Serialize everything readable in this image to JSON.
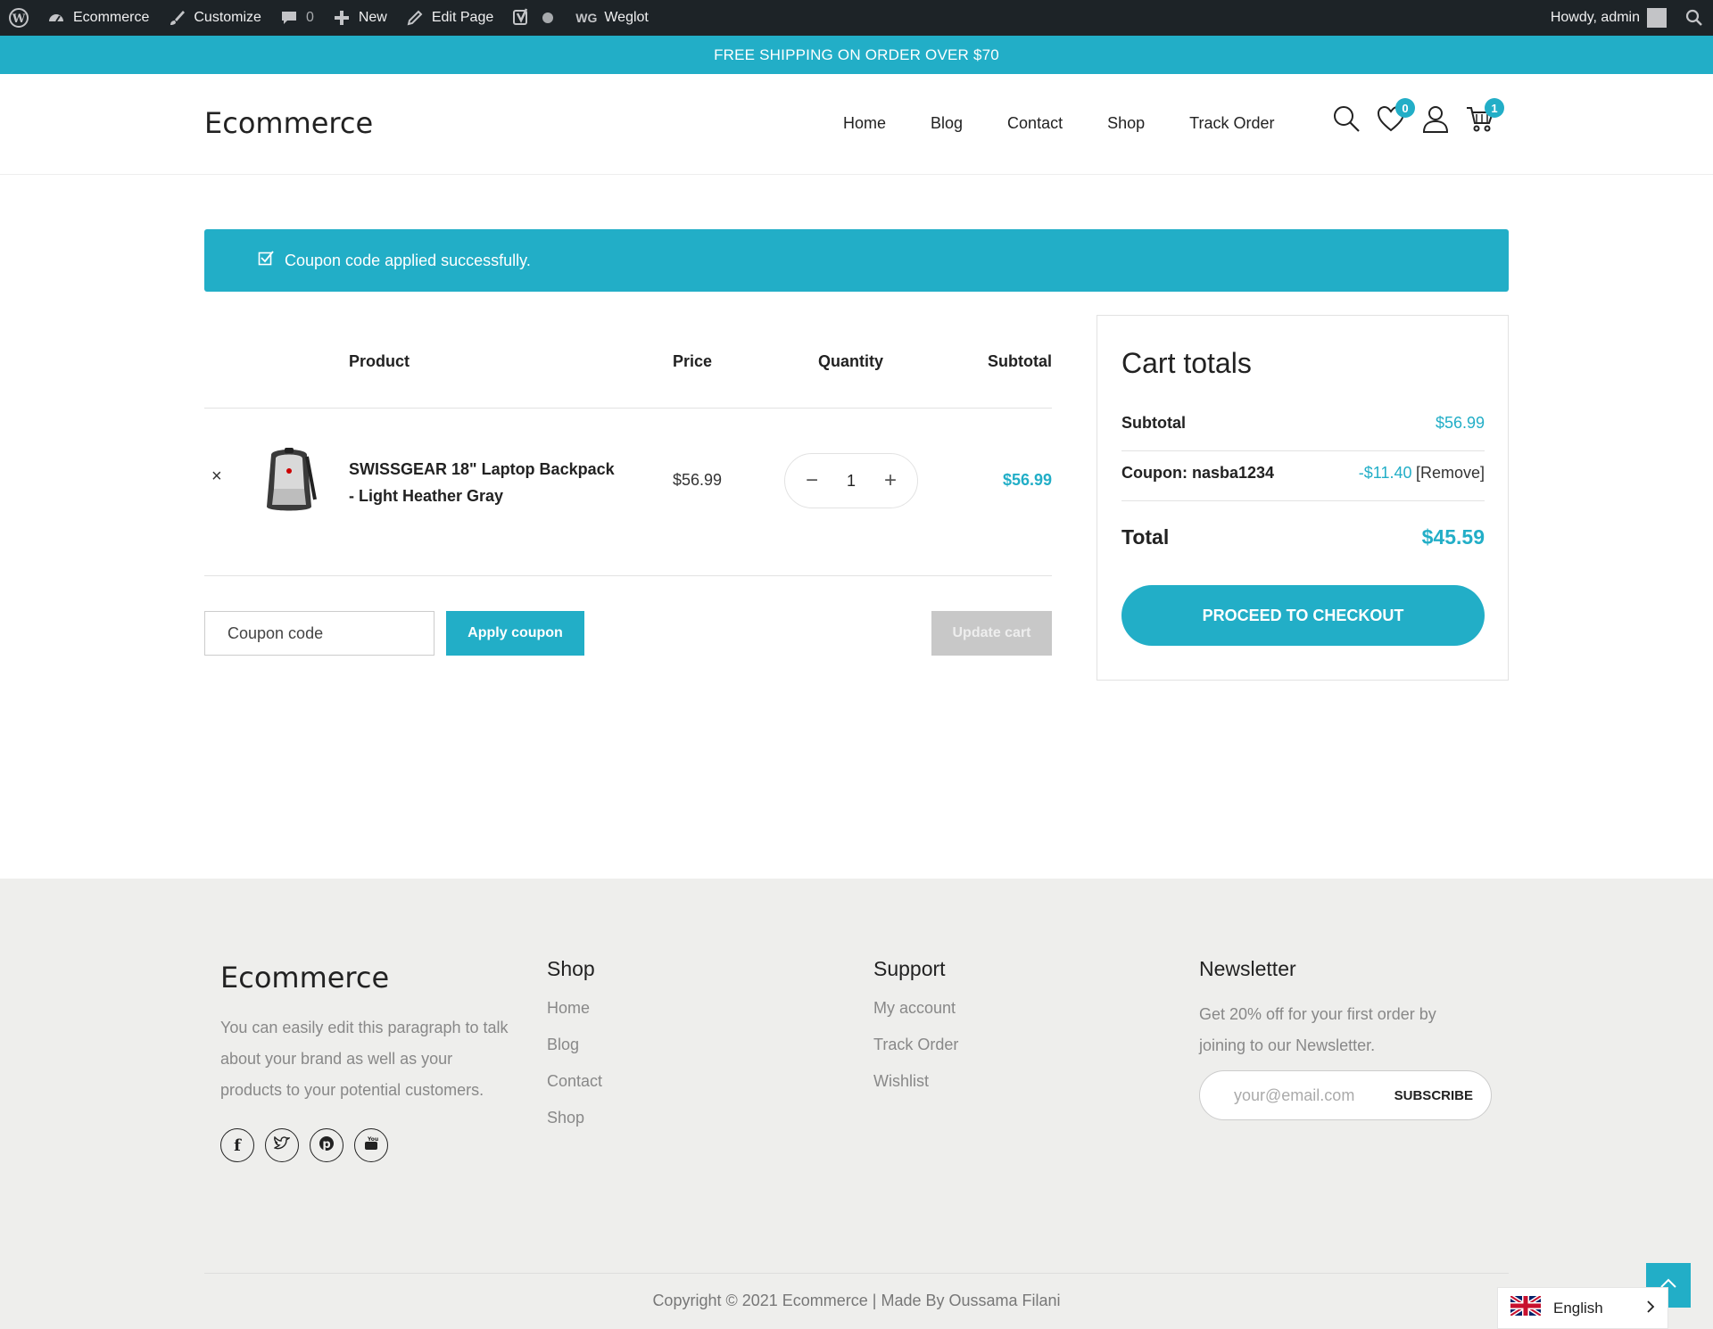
{
  "adminbar": {
    "site_name": "Ecommerce",
    "customize": "Customize",
    "comments_count": "0",
    "new": "New",
    "edit_page": "Edit Page",
    "weglot_prefix": "WG",
    "weglot": "Weglot",
    "howdy": "Howdy, admin"
  },
  "promo": {
    "text": "FREE SHIPPING ON ORDER OVER $70"
  },
  "header": {
    "logo": "Ecommerce",
    "nav": [
      "Home",
      "Blog",
      "Contact",
      "Shop",
      "Track Order"
    ],
    "wishlist_count": "0",
    "cart_count": "1"
  },
  "notice": {
    "text": "Coupon code applied successfully."
  },
  "cart": {
    "headers": {
      "product": "Product",
      "price": "Price",
      "quantity": "Quantity",
      "subtotal": "Subtotal"
    },
    "remove": "×",
    "item": {
      "name": "SWISSGEAR 18\" Laptop Backpack - Light Heather Gray",
      "price": "$56.99",
      "quantity": "1",
      "subtotal": "$56.99"
    },
    "coupon_placeholder": "Coupon code",
    "apply_label": "Apply coupon",
    "update_label": "Update cart"
  },
  "totals": {
    "title": "Cart totals",
    "subtotal_label": "Subtotal",
    "subtotal_value": "$56.99",
    "coupon_label": "Coupon: nasba1234",
    "coupon_value": "-$11.40",
    "coupon_remove": "[Remove]",
    "total_label": "Total",
    "total_value": "$45.59",
    "checkout_label": "PROCEED TO CHECKOUT"
  },
  "footer": {
    "logo": "Ecommerce",
    "about": "You can easily edit this paragraph to talk about your brand as well as your products to your potential customers.",
    "shop_title": "Shop",
    "shop_links": [
      "Home",
      "Blog",
      "Contact",
      "Shop"
    ],
    "support_title": "Support",
    "support_links": [
      "My account",
      "Track Order",
      "Wishlist"
    ],
    "newsletter_title": "Newsletter",
    "newsletter_text": "Get 20% off for your first order by joining to our Newsletter.",
    "email_placeholder": "your@email.com",
    "subscribe_label": "SUBSCRIBE",
    "copyright": "Copyright © 2021 Ecommerce | Made By Oussama Filani"
  },
  "language": {
    "current": "English"
  },
  "colors": {
    "accent": "#22aec7",
    "adminbar": "#1d2327",
    "footer_bg": "#eeeeec"
  }
}
